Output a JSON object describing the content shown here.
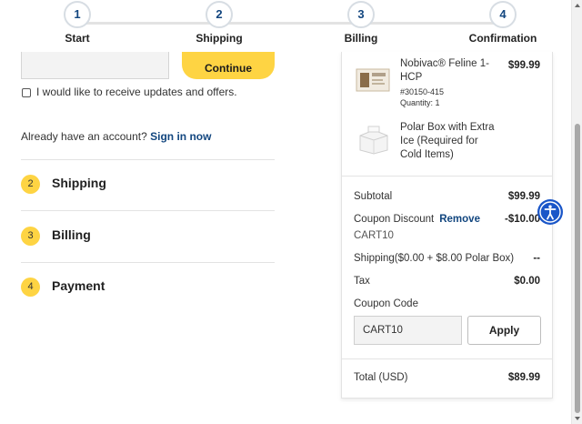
{
  "progress": {
    "steps": [
      {
        "number": "1",
        "label": "Start"
      },
      {
        "number": "2",
        "label": "Shipping"
      },
      {
        "number": "3",
        "label": "Billing"
      },
      {
        "number": "4",
        "label": "Confirmation"
      }
    ]
  },
  "start": {
    "email_value": "",
    "continue_label": "Continue",
    "optin_label": "I would like to receive updates and offers.",
    "optin_checked": false,
    "signin_prompt": "Already have an account?",
    "signin_link": "Sign in now"
  },
  "sections": [
    {
      "number": "2",
      "title": "Shipping"
    },
    {
      "number": "3",
      "title": "Billing"
    },
    {
      "number": "4",
      "title": "Payment"
    }
  ],
  "summary": {
    "items": [
      {
        "name": "Nobivac® Feline 1-HCP",
        "sku": "#30150-415",
        "quantity": "Quantity: 1",
        "price": "$99.99",
        "icon": "vaccine-box-image"
      },
      {
        "name": "Polar Box with Extra Ice (Required for Cold Items)",
        "icon": "polar-box-image"
      }
    ],
    "subtotal_label": "Subtotal",
    "subtotal_value": "$99.99",
    "coupon_discount_label": "Coupon Discount",
    "coupon_remove_label": "Remove",
    "coupon_discount_value": "-$10.00",
    "applied_coupon": "CART10",
    "shipping_label": "Shipping($0.00 + $8.00 Polar Box)",
    "shipping_value": "--",
    "tax_label": "Tax",
    "tax_value": "$0.00",
    "coupon_code_label": "Coupon Code",
    "coupon_input_value": "CART10",
    "apply_label": "Apply",
    "total_label": "Total (USD)",
    "total_value": "$89.99"
  },
  "colors": {
    "accent_yellow": "#fed443",
    "link_blue": "#12467f",
    "a11y_blue": "#1a56c8"
  }
}
